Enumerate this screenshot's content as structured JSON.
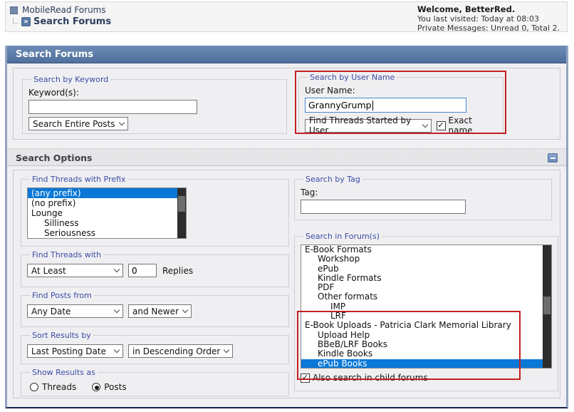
{
  "header": {
    "forum_title": "MobileRead Forums",
    "page_title": "Search Forums",
    "welcome": "Welcome, BetterRed.",
    "last_visited": "You last visited: Today at 08:03",
    "private_messages": "Private Messages: Unread 0, Total 2."
  },
  "title_bar": "Search Forums",
  "keyword_section": {
    "legend": "Search by Keyword",
    "label": "Keyword(s):",
    "value": "",
    "search_type": "Search Entire Posts"
  },
  "username_section": {
    "legend": "Search by User Name",
    "label": "User Name:",
    "value": "GrannyGrump",
    "search_type": "Find Threads Started by User",
    "exact_name_label": "Exact name",
    "exact_name_checked": true
  },
  "options_header": "Search Options",
  "prefix_section": {
    "legend": "Find Threads with Prefix",
    "options": [
      {
        "label": "(any prefix)",
        "indent": 0,
        "selected": true
      },
      {
        "label": "(no prefix)",
        "indent": 0
      },
      {
        "label": "Lounge",
        "indent": 0
      },
      {
        "label": "Silliness",
        "indent": 1
      },
      {
        "label": "Seriousness",
        "indent": 1
      }
    ]
  },
  "replies_section": {
    "legend": "Find Threads with",
    "comparator": "At Least",
    "count": "0",
    "suffix": "Replies"
  },
  "date_section": {
    "legend": "Find Posts from",
    "date": "Any Date",
    "direction": "and Newer"
  },
  "sort_section": {
    "legend": "Sort Results by",
    "field": "Last Posting Date",
    "order": "in Descending Order"
  },
  "show_section": {
    "legend": "Show Results as",
    "options": [
      {
        "label": "Threads",
        "selected": false
      },
      {
        "label": "Posts",
        "selected": true
      }
    ]
  },
  "tag_section": {
    "legend": "Search by Tag",
    "label": "Tag:",
    "value": ""
  },
  "forum_section": {
    "legend": "Search in Forum(s)",
    "options": [
      {
        "label": "E-Book Formats",
        "indent": 0
      },
      {
        "label": "Workshop",
        "indent": 1
      },
      {
        "label": "ePub",
        "indent": 1
      },
      {
        "label": "Kindle Formats",
        "indent": 1
      },
      {
        "label": "PDF",
        "indent": 1
      },
      {
        "label": "Other formats",
        "indent": 1
      },
      {
        "label": "IMP",
        "indent": 2
      },
      {
        "label": "LRF",
        "indent": 2
      },
      {
        "label": "E-Book Uploads - Patricia Clark Memorial Library",
        "indent": 0
      },
      {
        "label": "Upload Help",
        "indent": 1
      },
      {
        "label": "BBeB/LRF Books",
        "indent": 1
      },
      {
        "label": "Kindle Books",
        "indent": 1
      },
      {
        "label": "ePub Books",
        "indent": 1,
        "selected": true
      }
    ],
    "child_forums_label": "Also search in child forums",
    "child_forums_checked": true
  },
  "icons": {
    "goto_arrow": "»",
    "check": "✓"
  },
  "colors": {
    "title_bar_top": "#6d8cb6",
    "title_bar_bottom": "#4f6f9c",
    "legend_blue": "#3c4ba3",
    "selection_blue": "#0a78d7",
    "annotation_red": "#c52020",
    "navy_text": "#2c3e5c",
    "scrollbar_track": "#2d2d2d",
    "scrollbar_thumb": "#6e6e6e"
  }
}
